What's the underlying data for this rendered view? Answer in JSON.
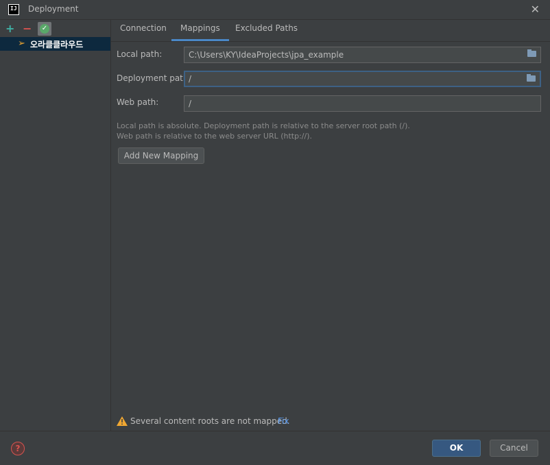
{
  "window": {
    "title": "Deployment",
    "app_icon_text": "IJ"
  },
  "toolbar": {
    "add": "+",
    "remove": "−"
  },
  "servers": [
    {
      "label": "오라클클라우드"
    }
  ],
  "tabs": [
    {
      "label": "Connection"
    },
    {
      "label": "Mappings"
    },
    {
      "label": "Excluded Paths"
    }
  ],
  "mapping": {
    "local_label": "Local path:",
    "local_value": "C:\\Users\\KY\\IdeaProjects\\jpa_example",
    "deploy_label": "Deployment path:",
    "deploy_value": "/",
    "web_label": "Web path:",
    "web_value": "/",
    "hint1": "Local path is absolute. Deployment path is relative to the server root path (/).",
    "hint2": "Web path is relative to the web server URL (http://).",
    "add_button": "Add New Mapping"
  },
  "warning": {
    "text": "Several content roots are not mapped.",
    "fix": "Fix"
  },
  "footer": {
    "help": "?",
    "ok": "OK",
    "cancel": "Cancel"
  },
  "colors": {
    "accent": "#4a88c7",
    "ok_button": "#365880",
    "selection": "#0d293e"
  }
}
